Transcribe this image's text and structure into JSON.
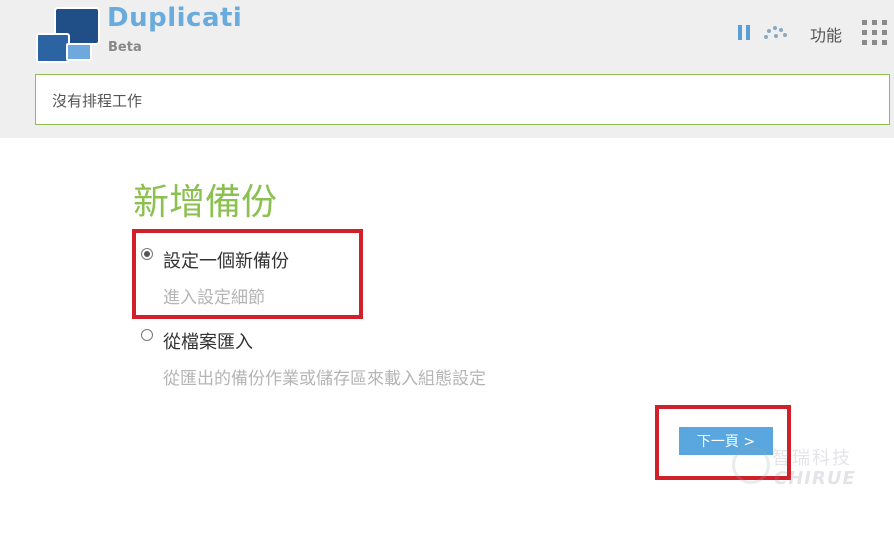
{
  "app": {
    "title": "Duplicati",
    "subtitle": "Beta"
  },
  "header": {
    "menu_label": "功能"
  },
  "status": {
    "text": "沒有排程工作"
  },
  "page": {
    "title": "新增備份"
  },
  "options": [
    {
      "label": "設定一個新備份",
      "description": "進入設定細節",
      "selected": true
    },
    {
      "label": "從檔案匯入",
      "description": "從匯出的備份作業或儲存區來載入組態設定",
      "selected": false
    }
  ],
  "actions": {
    "next_label": "下一頁 >"
  },
  "watermark": {
    "cn": "智瑞科技",
    "en": "CHIRUE"
  },
  "colors": {
    "brand": "#6aabdd",
    "title_green": "#8cc152",
    "highlight": "#d0202a",
    "button": "#5aa6de"
  },
  "icons": [
    "logo-icon",
    "pause-icon",
    "throttle-icon",
    "grid-menu-icon"
  ]
}
